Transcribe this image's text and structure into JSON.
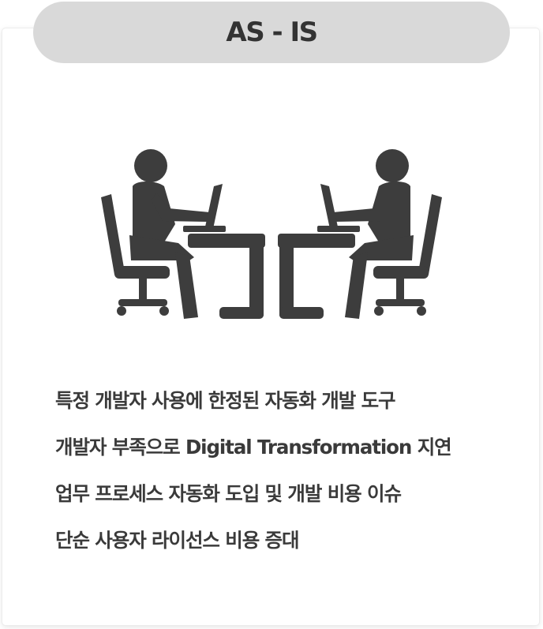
{
  "header": {
    "title": "AS - IS"
  },
  "illustration": {
    "icon": "two-people-at-laptops-icon",
    "color": "#3d3d3d"
  },
  "issues": [
    "특정 개발자 사용에 한정된 자동화 개발 도구",
    "개발자 부족으로  Digital Transformation 지연",
    "업무 프로세스 자동화 도입 및 개발 비용 이슈",
    "단순 사용자 라이선스 비용 증대"
  ],
  "colors": {
    "pill_background": "#d9d9d9",
    "title_text": "#333333",
    "body_text": "#3a3a3a",
    "card_background": "#ffffff"
  }
}
